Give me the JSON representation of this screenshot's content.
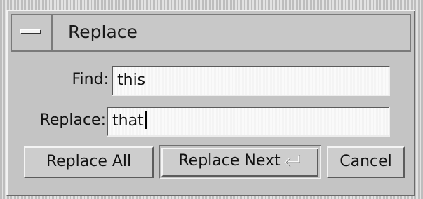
{
  "window": {
    "title": "Replace",
    "menu_icon": "window-menu-icon"
  },
  "find": {
    "label": "Find:",
    "value": "this"
  },
  "replace": {
    "label": "Replace:",
    "value": "that"
  },
  "buttons": {
    "replace_all": "Replace All",
    "replace_next": "Replace Next",
    "replace_next_icon": "return-key-icon",
    "cancel": "Cancel"
  }
}
